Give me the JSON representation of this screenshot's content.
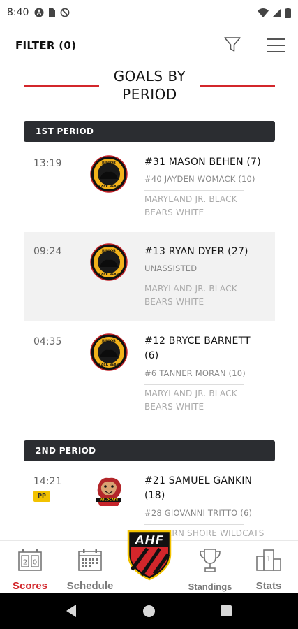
{
  "status_bar": {
    "time": "8:40",
    "icons": [
      "notification-a-icon",
      "sim-icon",
      "do-not-disturb-icon"
    ],
    "right_icons": [
      "wifi-icon",
      "signal-icon",
      "battery-icon"
    ]
  },
  "header": {
    "filter_label": "FILTER (0)",
    "filter_icon": "filter-icon",
    "menu_icon": "hamburger-menu-icon"
  },
  "page": {
    "title_line1": "GOALS BY",
    "title_line2": "PERIOD"
  },
  "colors": {
    "accent_red": "#d3262b",
    "header_dark": "#2b2d31",
    "pp_yellow": "#f2c200"
  },
  "periods": [
    {
      "label": "1ST PERIOD",
      "goals": [
        {
          "time": "13:19",
          "scorer": "#31 MASON BEHEN (7)",
          "assist": "#40 JAYDEN WOMACK (10)",
          "team_line1": "MARYLAND JR. BLACK",
          "team_line2": "BEARS WHITE",
          "logo_text": "JUNIOR BLACK BEARS"
        },
        {
          "time": "09:24",
          "scorer": "#13 RYAN DYER (27)",
          "assist": "UNASSISTED",
          "team_line1": "MARYLAND JR. BLACK",
          "team_line2": "BEARS WHITE",
          "logo_text": "JUNIOR BLACK BEARS"
        },
        {
          "time": "04:35",
          "scorer_line1": "#12 BRYCE BARNETT",
          "scorer_line2": "(6)",
          "assist": "#6 TANNER MORAN (10)",
          "team_line1": "MARYLAND JR. BLACK",
          "team_line2": "BEARS WHITE",
          "logo_text": "JUNIOR BLACK BEARS"
        }
      ]
    },
    {
      "label": "2ND PERIOD",
      "goals": [
        {
          "time": "14:21",
          "badge": "PP",
          "scorer_line1": "#21 SAMUEL GANKIN",
          "scorer_line2": "(18)",
          "assist": "#28 GIOVANNI TRITTO (6)",
          "team_line1": "EASTERN SHORE WILDCATS",
          "logo_text": "WILDCATS"
        }
      ]
    }
  ],
  "bottom_nav": {
    "items": [
      {
        "label": "Scores",
        "icon": "scoreboard-icon",
        "active": true
      },
      {
        "label": "Schedule",
        "icon": "calendar-icon",
        "active": false
      },
      {
        "label": "AHF",
        "icon": "ahf-logo"
      },
      {
        "label": "Standings",
        "icon": "trophy-icon",
        "active": false
      },
      {
        "label": "Stats",
        "icon": "podium-icon",
        "active": false
      }
    ]
  },
  "android_nav": {
    "icons": [
      "back-icon",
      "home-icon",
      "recents-icon"
    ]
  }
}
